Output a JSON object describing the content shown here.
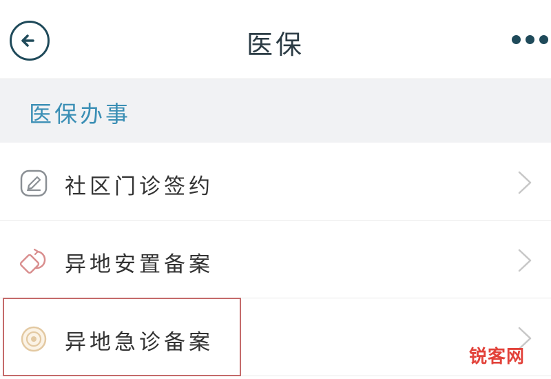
{
  "header": {
    "title": "医保",
    "back_icon": "back-arrow-icon",
    "more_icon": "more-dots-icon"
  },
  "section": {
    "label": "医保办事"
  },
  "items": [
    {
      "label": "社区门诊签约",
      "icon": "edit-icon",
      "chevron": "chevron-right-icon"
    },
    {
      "label": "异地安置备案",
      "icon": "relocation-icon",
      "chevron": "chevron-right-icon"
    },
    {
      "label": "异地急诊备案",
      "icon": "emergency-icon",
      "chevron": "chevron-right-icon",
      "highlighted": true
    }
  ],
  "watermark": "锐客网",
  "colors": {
    "accent": "#3b8fb5",
    "header_icon": "#1f4a5a",
    "highlight": "#c46a6a",
    "watermark": "#e2423a"
  }
}
